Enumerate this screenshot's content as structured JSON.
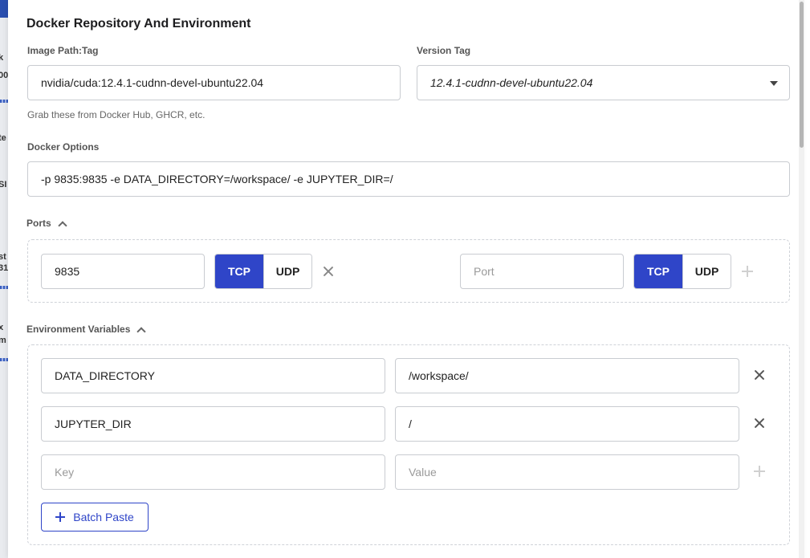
{
  "section_title": "Docker Repository And Environment",
  "image": {
    "label": "Image Path:Tag",
    "value": "nvidia/cuda:12.4.1-cudnn-devel-ubuntu22.04",
    "hint": "Grab these from Docker Hub, GHCR, etc."
  },
  "version": {
    "label": "Version Tag",
    "selected": "12.4.1-cudnn-devel-ubuntu22.04"
  },
  "docker_options": {
    "label": "Docker Options",
    "value": "-p 9835:9835 -e DATA_DIRECTORY=/workspace/ -e JUPYTER_DIR=/"
  },
  "ports": {
    "label": "Ports",
    "entries": [
      {
        "value": "9835",
        "protocol_options": [
          "TCP",
          "UDP"
        ],
        "selected": "TCP"
      }
    ],
    "new_entry": {
      "placeholder": "Port",
      "protocol_options": [
        "TCP",
        "UDP"
      ],
      "selected": "TCP"
    }
  },
  "env": {
    "label": "Environment Variables",
    "rows": [
      {
        "key": "DATA_DIRECTORY",
        "value": "/workspace/"
      },
      {
        "key": "JUPYTER_DIR",
        "value": "/"
      }
    ],
    "new_row": {
      "key_placeholder": "Key",
      "value_placeholder": "Value"
    },
    "batch_paste_label": "Batch Paste"
  },
  "background_fragments": [
    "k",
    "00",
    "te",
    "SI",
    "st",
    "31",
    "x",
    "m"
  ],
  "colors": {
    "accent": "#2f45c8",
    "border": "#c9ccd1"
  }
}
